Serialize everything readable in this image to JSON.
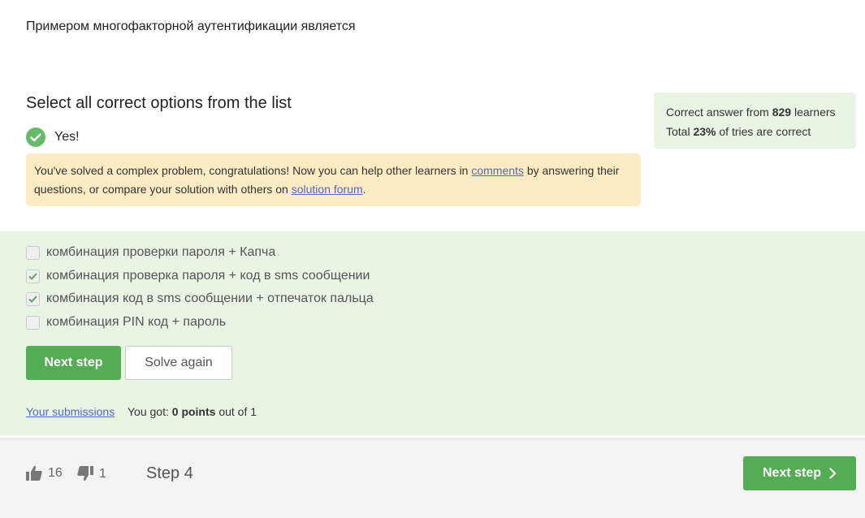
{
  "question": "Примером многофакторной аутентификации является",
  "task_heading": "Select all correct options from the list",
  "result": {
    "label": "Yes!"
  },
  "notice": {
    "text_before": "You've solved a complex problem, congratulations! Now you can help other learners in ",
    "comments_link": "comments",
    "text_middle": " by answering their questions, or compare your solution with others on ",
    "forum_link": "solution forum",
    "text_after": "."
  },
  "stats": {
    "line1_prefix": "Correct answer from ",
    "learners_count": "829",
    "line1_suffix": " learners",
    "line2_prefix": "Total ",
    "percent": "23%",
    "line2_suffix": " of tries are correct"
  },
  "options": [
    {
      "label": "комбинация проверки пароля + Капча",
      "checked": false
    },
    {
      "label": "комбинация проверка пароля + код в sms сообщении",
      "checked": true
    },
    {
      "label": "комбинация код в sms сообщении + отпечаток пальца",
      "checked": true
    },
    {
      "label": "комбинация PIN код + пароль",
      "checked": false
    }
  ],
  "buttons": {
    "next_step": "Next step",
    "solve_again": "Solve again"
  },
  "submissions_link": "Your submissions",
  "score": {
    "prefix": "You got: ",
    "points": "0 points",
    "suffix": " out of 1"
  },
  "footer": {
    "likes": "16",
    "dislikes": "1",
    "step_label": "Step 4",
    "next_step": "Next step"
  },
  "colors": {
    "accent_green": "#54ad54",
    "success_bg": "#e8f5e4",
    "notice_bg": "#fdebc4",
    "link": "#4c6ac2"
  }
}
